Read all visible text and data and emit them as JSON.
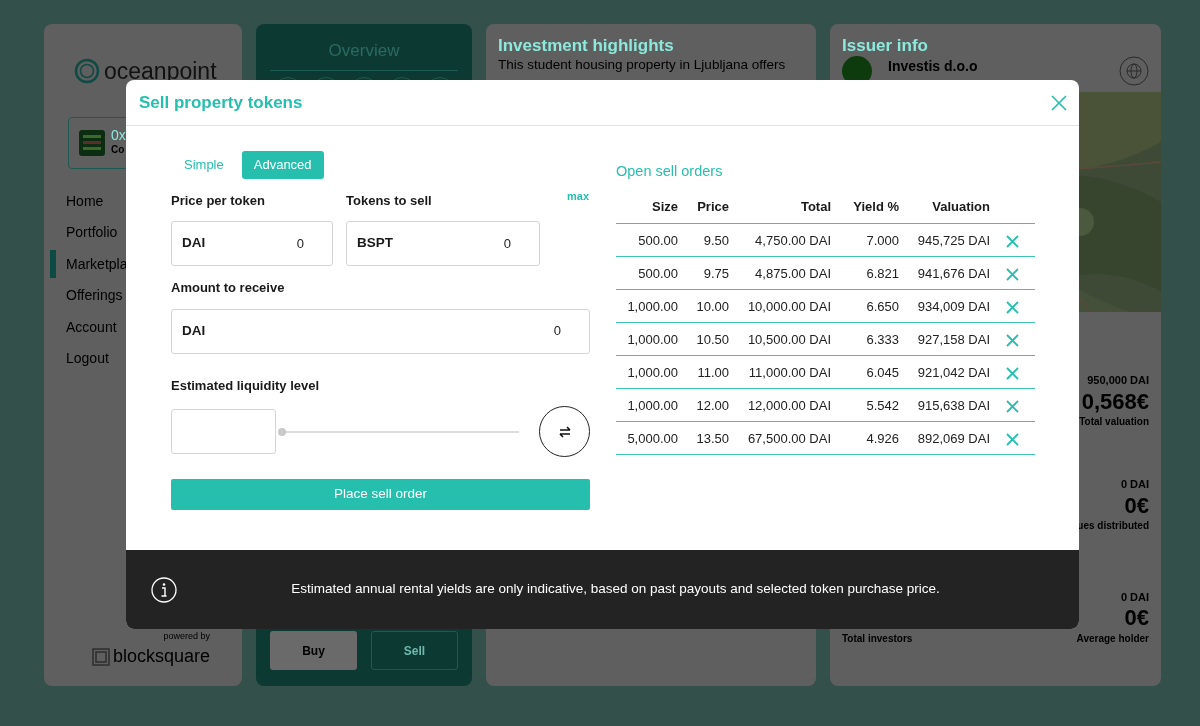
{
  "sidebar": {
    "logo": "oceanpoint",
    "wallet": {
      "address": "0x",
      "label": "Co"
    },
    "items": [
      {
        "label": "Home",
        "selected": false
      },
      {
        "label": "Portfolio",
        "selected": false
      },
      {
        "label": "Marketpla",
        "selected": true
      },
      {
        "label": "Offerings",
        "selected": false
      },
      {
        "label": "Account",
        "selected": false
      },
      {
        "label": "Logout",
        "selected": false
      }
    ],
    "powered_by": "powered by",
    "brand": "blocksquare"
  },
  "overview": {
    "title": "Overview",
    "buttons": [
      {
        "label": "Buy",
        "kind": "filled"
      },
      {
        "label": "Sell",
        "kind": "outline"
      }
    ]
  },
  "highlights": {
    "title": "Investment highlights",
    "text": "This student housing property in Ljubljana offers"
  },
  "issuer": {
    "title": "Issuer info",
    "name": "Investis d.o.o",
    "stats": [
      {
        "amount": "950,000 DAI",
        "value": "0,568€",
        "label": "Total valuation"
      },
      {
        "amount": "0 DAI",
        "value": "0€",
        "label": "ues distributed"
      }
    ],
    "footer_stats": [
      {
        "label": "Total investors"
      },
      {
        "amount": "0 DAI",
        "value": "0€",
        "label": "Average holder"
      }
    ]
  },
  "modal": {
    "title": "Sell property tokens",
    "tabs": [
      {
        "label": "Simple",
        "selected": false
      },
      {
        "label": "Advanced",
        "selected": true
      }
    ],
    "fields": [
      {
        "label": "Price per token",
        "unit": "DAI",
        "value": "0"
      },
      {
        "label": "Tokens to sell",
        "unit": "BSPT",
        "value": "0",
        "link": "max"
      }
    ],
    "receive": {
      "label": "Amount to receive",
      "unit": "DAI",
      "value": "0"
    },
    "liquidity": {
      "label": "Estimated liquidity level",
      "level": 0
    },
    "submit": "Place sell order",
    "orders": {
      "title": "Open sell orders",
      "columns": [
        "Size",
        "Price",
        "Total",
        "Yield %",
        "Valuation"
      ],
      "rows": [
        [
          "500.00",
          "9.50",
          "4,750.00 DAI",
          "7.000",
          "945,725 DAI"
        ],
        [
          "500.00",
          "9.75",
          "4,875.00 DAI",
          "6.821",
          "941,676 DAI"
        ],
        [
          "1,000.00",
          "10.00",
          "10,000.00 DAI",
          "6.650",
          "934,009 DAI"
        ],
        [
          "1,000.00",
          "10.50",
          "10,500.00 DAI",
          "6.333",
          "927,158 DAI"
        ],
        [
          "1,000.00",
          "11.00",
          "11,000.00 DAI",
          "6.045",
          "921,042 DAI"
        ],
        [
          "1,000.00",
          "12.00",
          "12,000.00 DAI",
          "5.542",
          "915,638 DAI"
        ],
        [
          "5,000.00",
          "13.50",
          "67,500.00 DAI",
          "4.926",
          "892,069 DAI"
        ]
      ]
    },
    "notice": "Estimated annual rental yields are only indicative, based on past payouts and selected token purchase price."
  }
}
